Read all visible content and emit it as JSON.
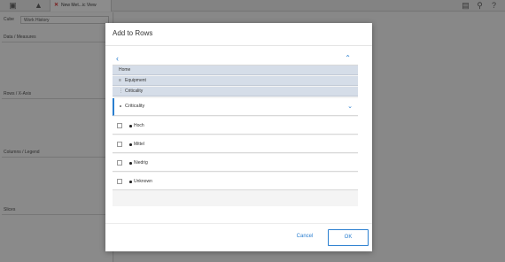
{
  "app": {
    "tab_title": "New Met...ic View",
    "cube_label": "Cube",
    "cube_value": "Work History",
    "sections": [
      "Data / Measures",
      "Rows / X-Axis",
      "Columns / Legend",
      "Slices"
    ]
  },
  "dialog": {
    "title": "Add to Rows",
    "breadcrumbs": [
      {
        "label": "Home",
        "icon": ""
      },
      {
        "label": "Equipment",
        "icon": "hierarchy-icon"
      },
      {
        "label": "Criticality",
        "icon": "level-icon"
      }
    ],
    "selected_level": "Criticality",
    "items": [
      "Hoch",
      "Mittel",
      "Niedrig",
      "Unknown"
    ],
    "cancel_label": "Cancel",
    "ok_label": "OK"
  },
  "colors": {
    "accent": "#2a7fd0",
    "crumb_bg": "#d5dde8",
    "overlay": "rgba(0,0,0,0.45)"
  }
}
